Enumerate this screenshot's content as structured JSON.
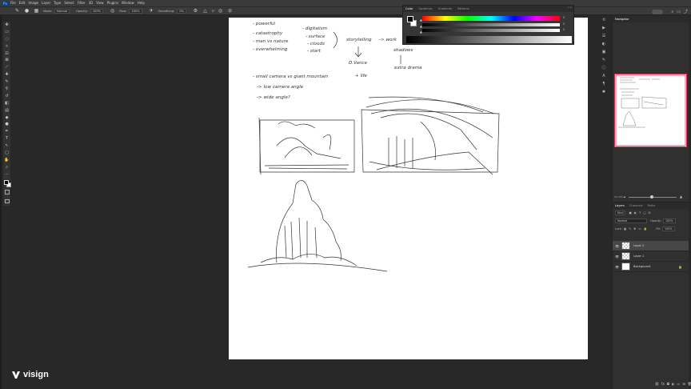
{
  "app": {
    "logo_text": "Ps"
  },
  "menu": [
    "File",
    "Edit",
    "Image",
    "Layer",
    "Type",
    "Select",
    "Filter",
    "3D",
    "View",
    "Plugins",
    "Window",
    "Help"
  ],
  "options": {
    "mode_label": "Mode:",
    "mode_value": "Normal",
    "opacity_label": "Opacity:",
    "opacity_value": "100%",
    "flow_label": "Flow:",
    "flow_value": "100%",
    "smoothing_label": "Smoothing:",
    "smoothing_value": "0%",
    "angle_value": "0°"
  },
  "color_panel": {
    "tabs": [
      "Color",
      "Swatches",
      "Gradients",
      "Patterns"
    ],
    "pct_values": [
      "0",
      "0",
      "0"
    ]
  },
  "navigator": {
    "tab": "Navigator",
    "zoom": "33.33%"
  },
  "layers_panel": {
    "tabs": [
      "Layers",
      "Channels",
      "Paths"
    ],
    "filter_kind": "Kind",
    "blend_mode": "Normal",
    "opacity_label": "Opacity:",
    "opacity_value": "100%",
    "lock_label": "Lock:",
    "fill_label": "Fill:",
    "fill_value": "100%",
    "layers": [
      {
        "name": "Layer 2",
        "selected": true,
        "transparent": true,
        "locked": false
      },
      {
        "name": "Layer 1",
        "selected": false,
        "transparent": true,
        "locked": false
      },
      {
        "name": "Background",
        "selected": false,
        "transparent": false,
        "locked": true
      }
    ]
  },
  "sketch_notes": {
    "line1": "- powerful",
    "line2": "- catastrophy",
    "line3": "- man vs nature",
    "line4": "- overwhelming",
    "col2a": "- digitalism",
    "col2b": "- surface",
    "col2c": "- clouds",
    "col2d": "- start",
    "center1": "storytelling",
    "right1": "-> work",
    "right2": "shadows",
    "below1": "D.Vance",
    "below2": "+ life",
    "below3": "extra drama",
    "list1": "- small camera vs giant mountain",
    "list2": "-> low camera angle",
    "list3": "-> wide angle?"
  },
  "watermark": {
    "brand": "visign"
  }
}
